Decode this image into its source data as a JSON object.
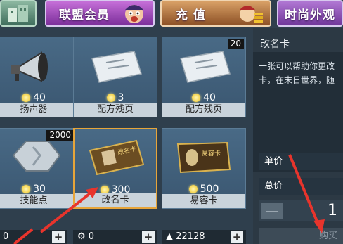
{
  "tabs": {
    "alliance": "联盟会员",
    "recharge": "充 值",
    "fashion": "时尚外观"
  },
  "items": [
    {
      "name": "扬声器",
      "price": "40",
      "stock": ""
    },
    {
      "name": "配方残页",
      "price": "3",
      "stock": ""
    },
    {
      "name": "配方残页",
      "price": "40",
      "stock": "20"
    },
    {
      "name": "技能点",
      "price": "30",
      "stock": "2000"
    },
    {
      "name": "改名卡",
      "price": "300",
      "stock": ""
    },
    {
      "name": "易容卡",
      "price": "500",
      "stock": ""
    }
  ],
  "card_labels": {
    "rename": "改名卡",
    "disguise": "易容卡"
  },
  "currencies": [
    {
      "value": "0"
    },
    {
      "value": "0"
    },
    {
      "value": "22128"
    }
  ],
  "detail": {
    "title": "改名卡",
    "desc_line1": "一张可以帮助你更改",
    "desc_line2": "卡，在末日世界，随",
    "unit_price_label": "单价",
    "total_price_label": "总价",
    "quantity": "1",
    "minus": "—",
    "buy_label": "购买"
  },
  "colors": {
    "selected_border": "#e7a53a",
    "annotation_arrow": "#e8342c"
  }
}
